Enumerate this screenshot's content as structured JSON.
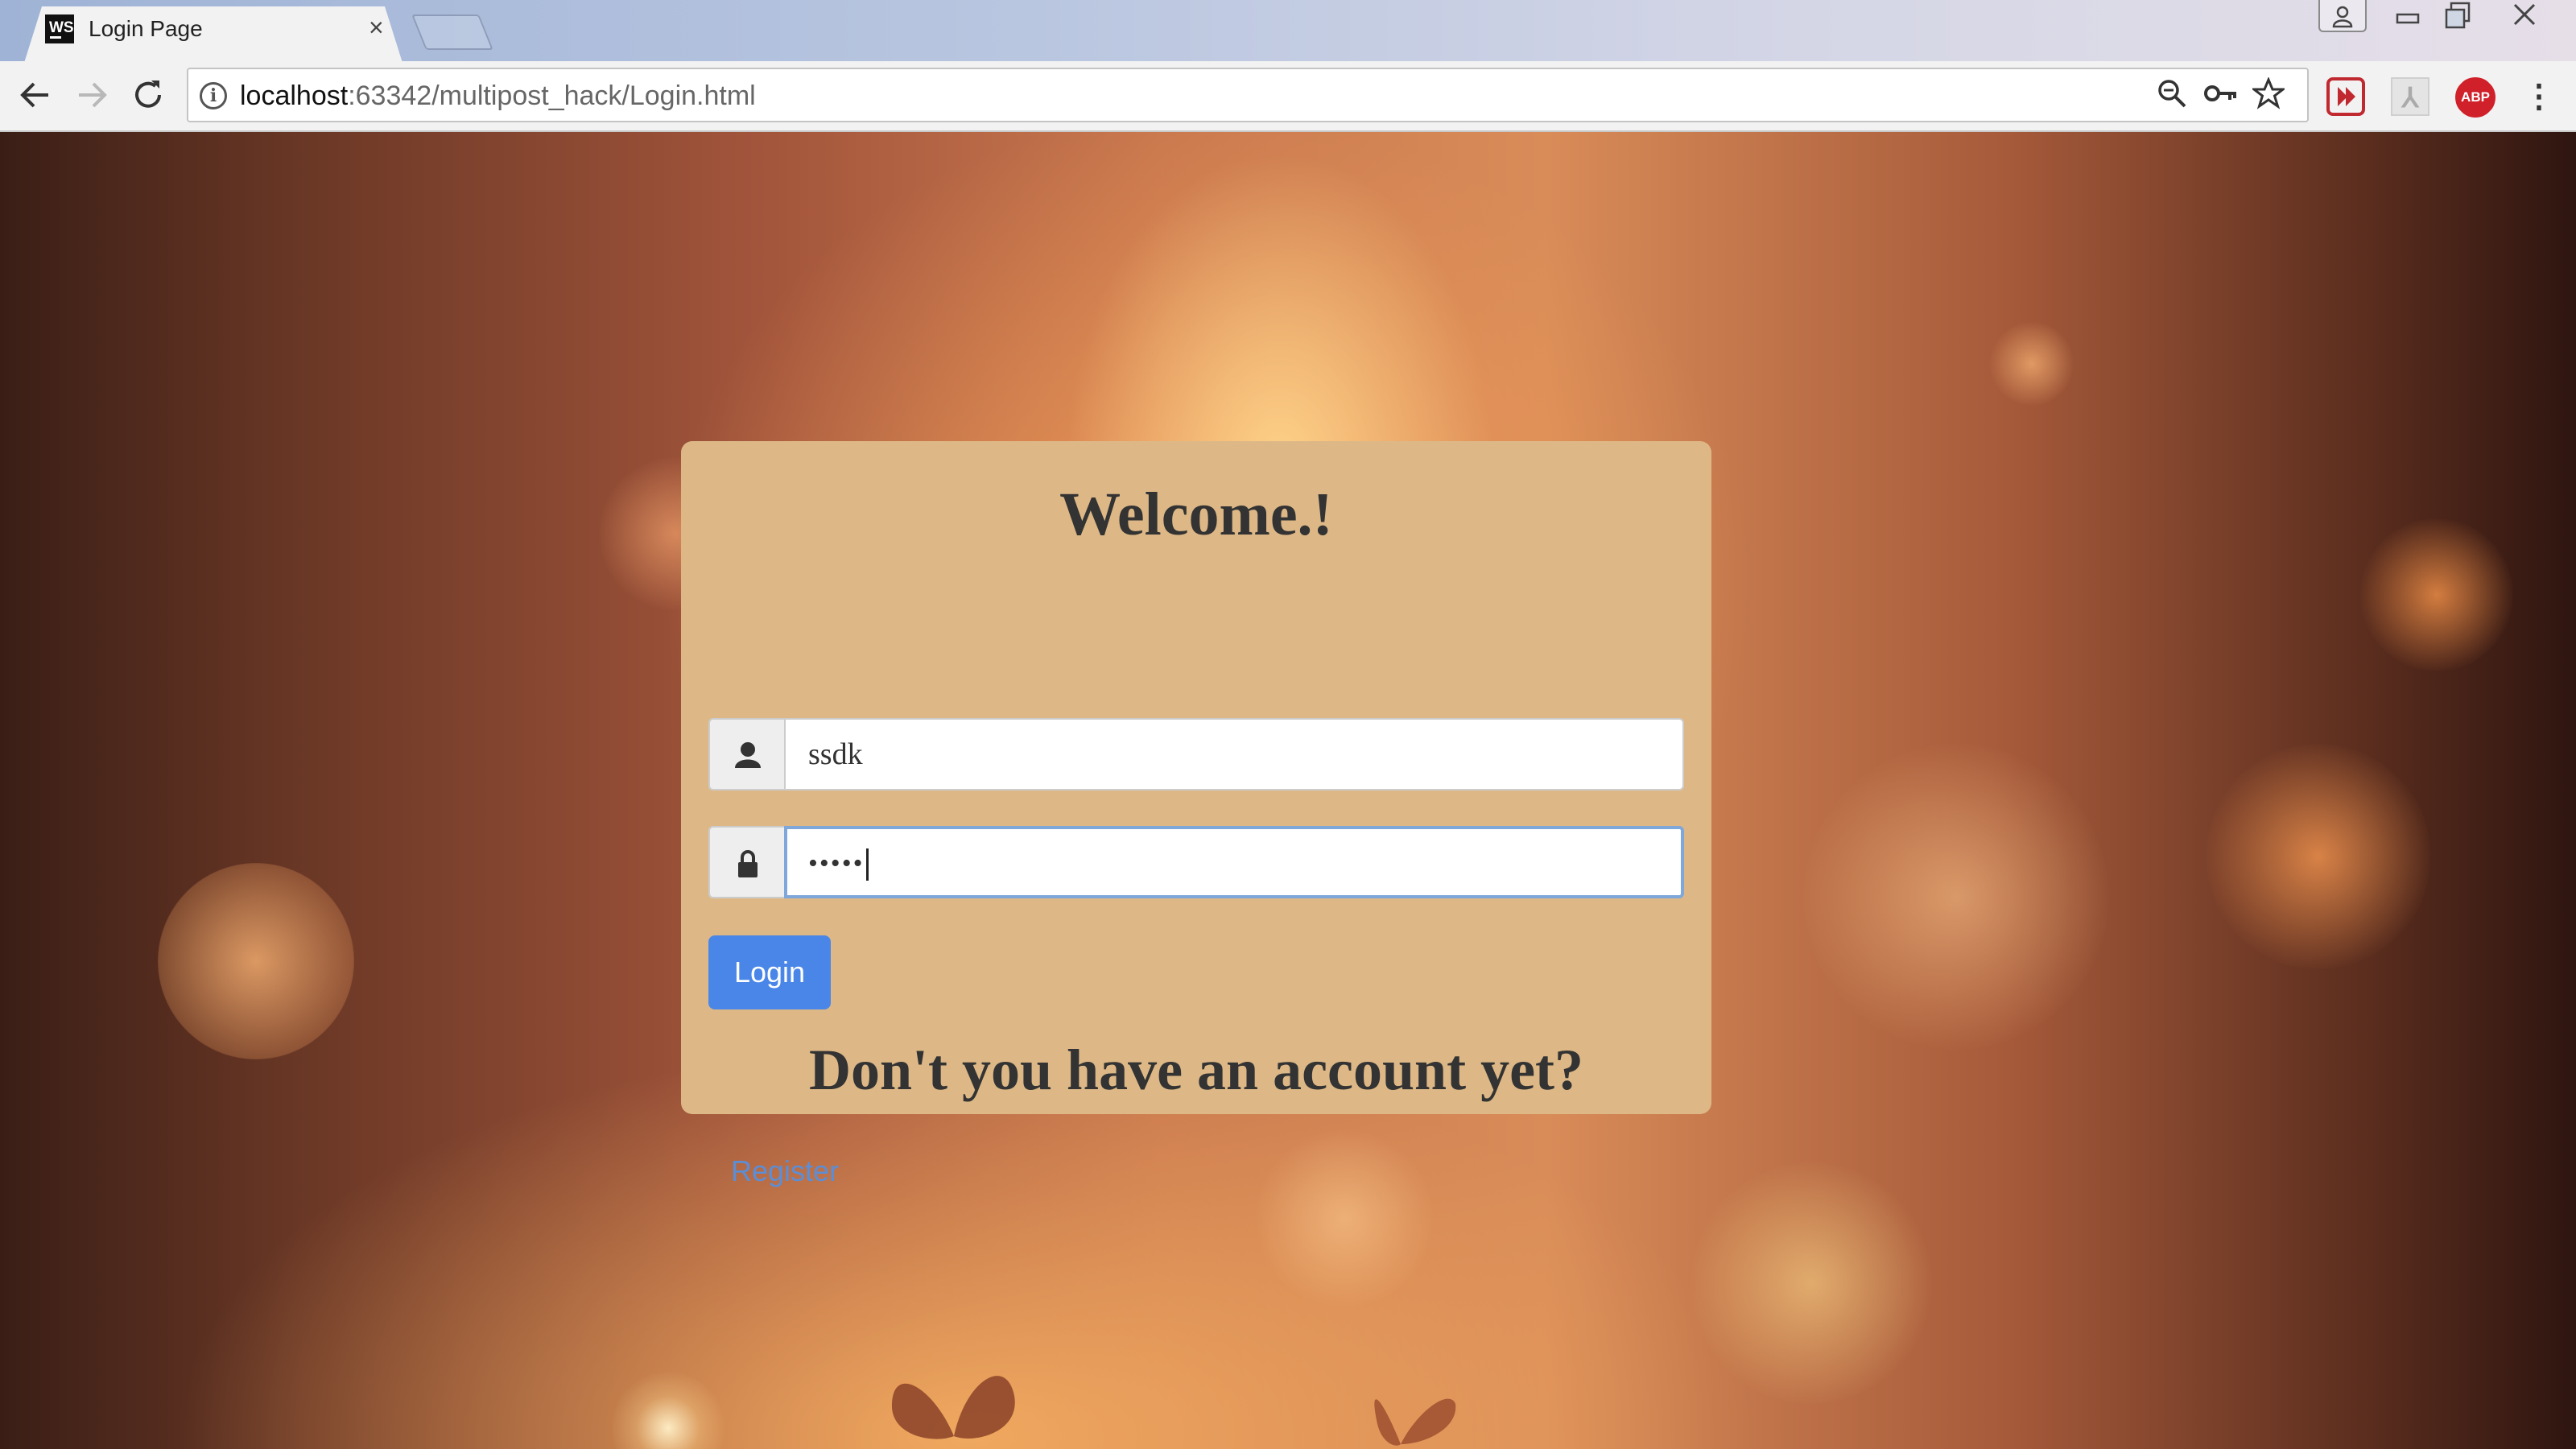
{
  "browser": {
    "tab_title": "Login Page",
    "tab_favicon_text": "WS",
    "tab_close": "×",
    "url_host": "localhost",
    "url_path": ":63342/multipost_hack/Login.html",
    "icons": {
      "back": "←",
      "forward": "→",
      "reload": "↻",
      "zoom": "⌕",
      "key": "⚷",
      "star": "☆",
      "ext_red": "▶",
      "ext_pdf": "⅄",
      "ext_abp": "ABP",
      "menu": "⋮",
      "win_user": "👤",
      "win_min": "▭",
      "win_max": "❐",
      "win_close": "✕"
    }
  },
  "page": {
    "title": "Welcome.!",
    "username": "ssdk",
    "password_masked": "•••••",
    "login_label": "Login",
    "subtitle": "Don't you have an account yet?",
    "register_label": "Register"
  },
  "colors": {
    "card_bg": "#ddb886",
    "login_button": "#4a86e8",
    "link": "#5b8ed6",
    "focus_border": "#7fa7d9"
  }
}
